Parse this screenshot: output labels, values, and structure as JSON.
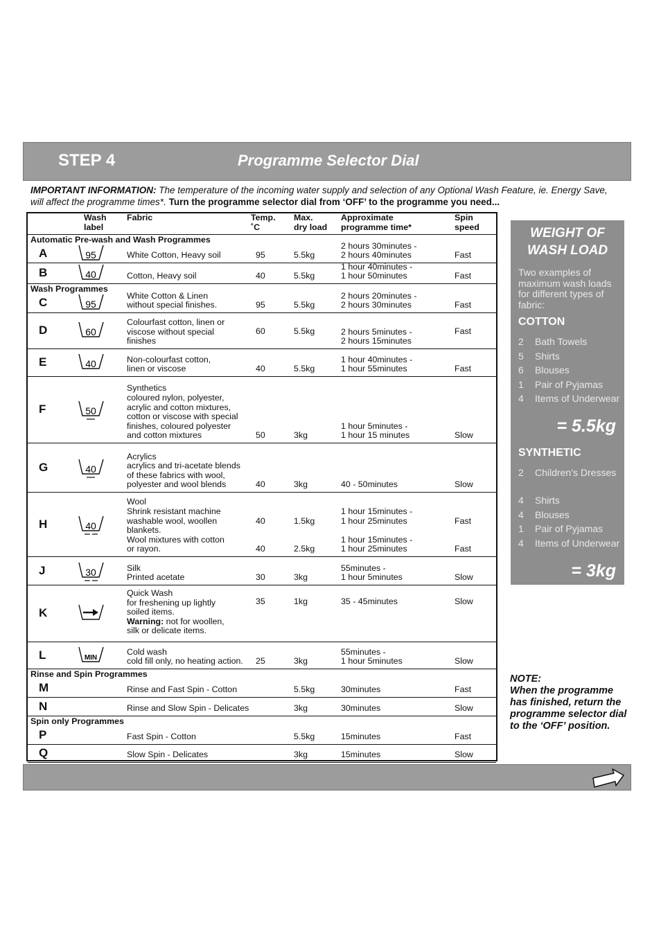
{
  "header": {
    "step": "STEP 4",
    "title": "Programme Selector Dial"
  },
  "info": {
    "label": "IMPORTANT INFORMATION:",
    "text": " The temperature of the incoming water supply and selection of any Optional Wash Feature, ie. Energy Save,  will affect the programme times*. ",
    "instruction": "Turn the programme selector dial from ‘OFF’ to the programme you need..."
  },
  "table": {
    "headers": {
      "wash_label": "Wash\nlabel",
      "fabric": "Fabric",
      "temp": "Temp.\n˚C",
      "load": "Max.\ndry load",
      "time": "Approximate\nprogramme time*",
      "spin": "Spin\nspeed"
    },
    "rows": [
      {
        "section": "Automatic Pre-wash and Wash Programmes",
        "letter": "A",
        "icon": {
          "type": "tub",
          "label": "95",
          "bars": 0
        },
        "fabric": "White Cotton, Heavy soil",
        "temp": "95",
        "load": "5.5kg",
        "time": "2 hours 30minutes -\n2 hours 40minutes",
        "spin": "Fast"
      },
      {
        "letter": "B",
        "icon": {
          "type": "tub",
          "label": "40",
          "bars": 0
        },
        "fabric": "Cotton, Heavy soil",
        "temp": "40",
        "load": "5.5kg",
        "time": "1 hour 40minutes -\n1 hour 50minutes",
        "spin": "Fast"
      },
      {
        "section": "Wash Programmes",
        "letter": "C",
        "icon": {
          "type": "tub",
          "label": "95",
          "bars": 0
        },
        "fabric": "White Cotton & Linen\nwithout special finishes.",
        "temp": "95",
        "load": "5.5kg",
        "time": "2 hours 20minutes -\n2 hours 30minutes",
        "spin": "Fast"
      },
      {
        "letter": "D",
        "icon": {
          "type": "tub",
          "label": "60",
          "bars": 0
        },
        "fabric": "Colourfast cotton, linen or\nviscose without special\nfinishes",
        "temp": "60",
        "load": "5.5kg",
        "time": "2 hours 5minutes -\n2 hours 15minutes",
        "spin": "Fast"
      },
      {
        "letter": "E",
        "icon": {
          "type": "tub",
          "label": "40",
          "bars": 0
        },
        "fabric": "Non-colourfast cotton,\nlinen or viscose",
        "temp": "40",
        "load": "5.5kg",
        "time": "1 hour 40minutes -\n1 hour 55minutes",
        "spin": "Fast"
      },
      {
        "letter": "F",
        "icon": {
          "type": "tub",
          "label": "50",
          "bars": 1
        },
        "fabric": "Synthetics\ncoloured nylon, polyester,\nacrylic and cotton mixtures,\ncotton or viscose with special\nfinishes, coloured polyester\nand cotton mixtures",
        "temp": "50",
        "load": "3kg",
        "time": "1 hour 5minutes -\n1 hour 15 minutes",
        "spin": "Slow"
      },
      {
        "letter": "G",
        "icon": {
          "type": "tub",
          "label": "40",
          "bars": 1
        },
        "fabric": "Acrylics\nacrylics and tri-acetate blends\nof these fabrics with wool,\npolyester and wool blends",
        "temp": "40",
        "load": "3kg",
        "time": "40 - 50minutes",
        "spin": "Slow"
      },
      {
        "letter": "H",
        "icon": {
          "type": "tub",
          "label": "40",
          "bars": 2
        },
        "fabric": "Wool\nShrink resistant machine\nwashable wool, woollen\nblankets.\nWool mixtures with cotton\nor rayon.",
        "temp": "40\n\n\n40",
        "load": "1.5kg\n\n\n2.5kg",
        "time": "1 hour 15minutes -\n1 hour 25minutes\n\n1 hour 15minutes -\n1 hour 25minutes",
        "spin": "Fast\n\n\nFast"
      },
      {
        "letter": "J",
        "icon": {
          "type": "tub",
          "label": "30",
          "bars": 2
        },
        "fabric": "Silk\nPrinted acetate",
        "temp": "30",
        "load": "3kg",
        "time": "55minutes -\n1 hour 5minutes",
        "spin": "Slow"
      },
      {
        "letter": "K",
        "icon": {
          "type": "arrow",
          "label": "",
          "bars": 0
        },
        "fabric": "Quick Wash\nfor freshening up lightly\nsoiled items.",
        "warning_label": "Warning:",
        "warning_text": " not for woollen,\nsilk or delicate items.",
        "temp": "35",
        "load": "1kg",
        "time": "35 - 45minutes",
        "spin": "Slow"
      },
      {
        "letter": "L",
        "icon": {
          "type": "tub",
          "label": "MIN",
          "bars": 0
        },
        "fabric": "Cold wash\ncold fill only, no heating action.",
        "temp": "25",
        "load": "3kg",
        "time": "55minutes -\n1 hour 5minutes",
        "spin": "Slow"
      },
      {
        "section": "Rinse and Spin Programmes",
        "letter": "M",
        "fabric": "Rinse and Fast Spin - Cotton",
        "load": "5.5kg",
        "time": "30minutes",
        "spin": "Fast"
      },
      {
        "letter": "N",
        "fabric": "Rinse and Slow Spin - Delicates",
        "load": "3kg",
        "time": "30minutes",
        "spin": "Slow"
      },
      {
        "section": "Spin only Programmes",
        "letter": "P",
        "fabric": "Fast Spin - Cotton",
        "load": "5.5kg",
        "time": "15minutes",
        "spin": "Fast"
      },
      {
        "letter": "Q",
        "fabric": "Slow Spin - Delicates",
        "load": "3kg",
        "time": "15minutes",
        "spin": "Slow"
      }
    ]
  },
  "sidebar": {
    "title": "WEIGHT OF\nWASH LOAD",
    "intro": "Two examples of maximum wash loads for different types of fabric:",
    "groups": [
      {
        "heading": "COTTON",
        "items": [
          {
            "qty": "2",
            "label": "Bath Towels"
          },
          {
            "qty": "5",
            "label": "Shirts"
          },
          {
            "qty": "6",
            "label": "Blouses"
          },
          {
            "qty": "1",
            "label": "Pair of Pyjamas"
          },
          {
            "qty": "4",
            "label": "Items of Underwear"
          }
        ],
        "total": "=  5.5kg"
      },
      {
        "heading": "SYNTHETIC",
        "items": [
          {
            "qty": "2",
            "label": "Children’s Dresses"
          },
          {
            "qty": "4",
            "label": "Shirts"
          },
          {
            "qty": "4",
            "label": "Blouses"
          },
          {
            "qty": "1",
            "label": "Pair of Pyjamas"
          },
          {
            "qty": "4",
            "label": "Items of Underwear"
          }
        ],
        "total": "=  3kg"
      }
    ]
  },
  "note": {
    "label": "NOTE:",
    "text": "When the programme has finished, return the programme selector dial to the ‘OFF’ position."
  },
  "footer": {
    "next_icon": "arrow-right-outline-icon"
  },
  "colors": {
    "bar": "#9c9c9c",
    "sidebar": "#8e8e8e"
  }
}
